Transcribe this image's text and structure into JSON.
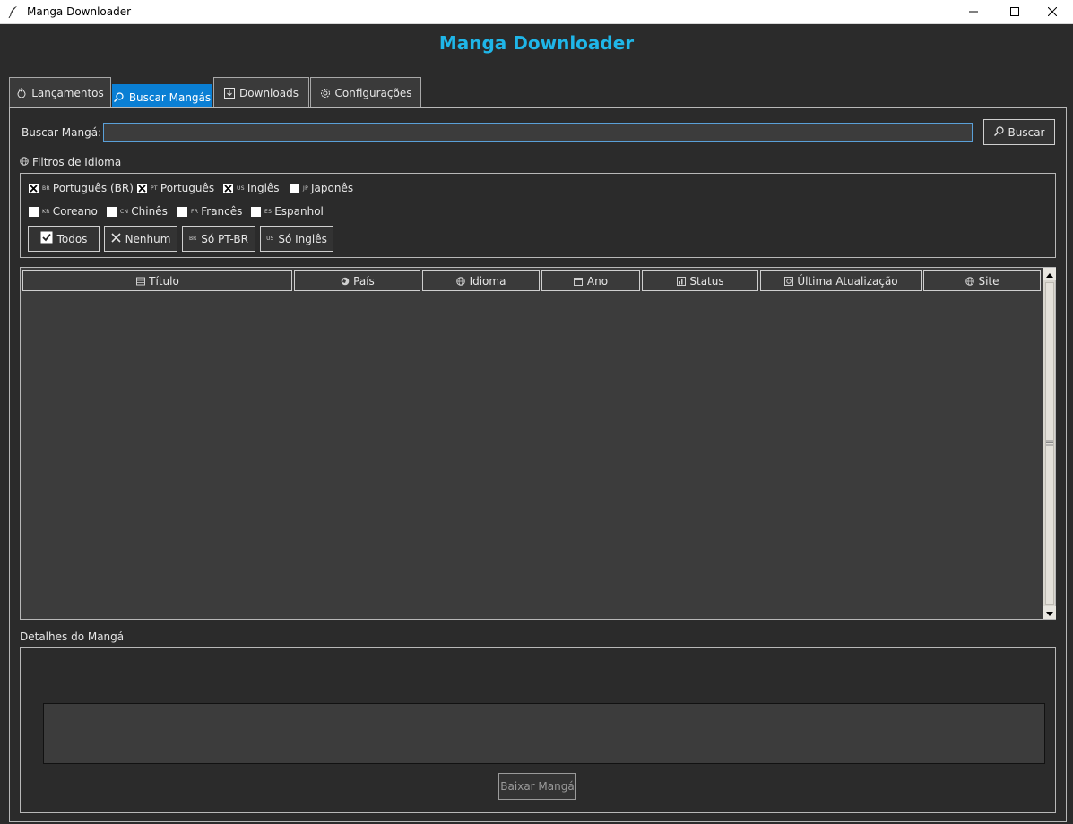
{
  "window": {
    "title": "Manga Downloader",
    "app_icon": "feather-icon",
    "controls": [
      "minimize",
      "maximize",
      "close"
    ]
  },
  "header": {
    "title": "Manga Downloader",
    "color": "#1fb6e8"
  },
  "tabs": [
    {
      "label": "Lançamentos",
      "icon": "fire-icon"
    },
    {
      "label": "Buscar Mangás",
      "icon": "magnifier-icon",
      "active": true
    },
    {
      "label": "Downloads",
      "icon": "download-icon"
    },
    {
      "label": "Configurações",
      "icon": "gear-icon"
    }
  ],
  "search": {
    "label": "Buscar Mangá:",
    "value": "",
    "button_label": "Buscar"
  },
  "filters": {
    "section_label": "Filtros de Idioma",
    "languages": [
      {
        "code": "BR",
        "label": "Português (BR)",
        "checked": true
      },
      {
        "code": "PT",
        "label": "Português",
        "checked": true
      },
      {
        "code": "US",
        "label": "Inglês",
        "checked": true
      },
      {
        "code": "JP",
        "label": "Japonês",
        "checked": false
      },
      {
        "code": "KR",
        "label": "Coreano",
        "checked": false
      },
      {
        "code": "CN",
        "label": "Chinês",
        "checked": false
      },
      {
        "code": "FR",
        "label": "Francês",
        "checked": false
      },
      {
        "code": "ES",
        "label": "Espanhol",
        "checked": false
      }
    ],
    "buttons": {
      "all": "Todos",
      "none": "Nenhum",
      "ptbr_code": "BR",
      "ptbr": "Só PT-BR",
      "english_code": "US",
      "english": "Só Inglês"
    }
  },
  "results_table": {
    "columns": [
      {
        "label": "Título",
        "icon": "book-icon"
      },
      {
        "label": "País",
        "icon": "globe-icon"
      },
      {
        "label": "Idioma",
        "icon": "language-icon"
      },
      {
        "label": "Ano",
        "icon": "calendar-icon"
      },
      {
        "label": "Status",
        "icon": "chart-icon"
      },
      {
        "label": "Última Atualização",
        "icon": "refresh-icon"
      },
      {
        "label": "Site",
        "icon": "web-icon"
      }
    ],
    "rows": []
  },
  "details": {
    "label": "Detalhes do Mangá",
    "text": "",
    "download_button": "Baixar Mangá"
  },
  "colors": {
    "background": "#2b2b2b",
    "panel": "#3c3c3c",
    "accent": "#0a7fd4",
    "title": "#1fb6e8"
  }
}
